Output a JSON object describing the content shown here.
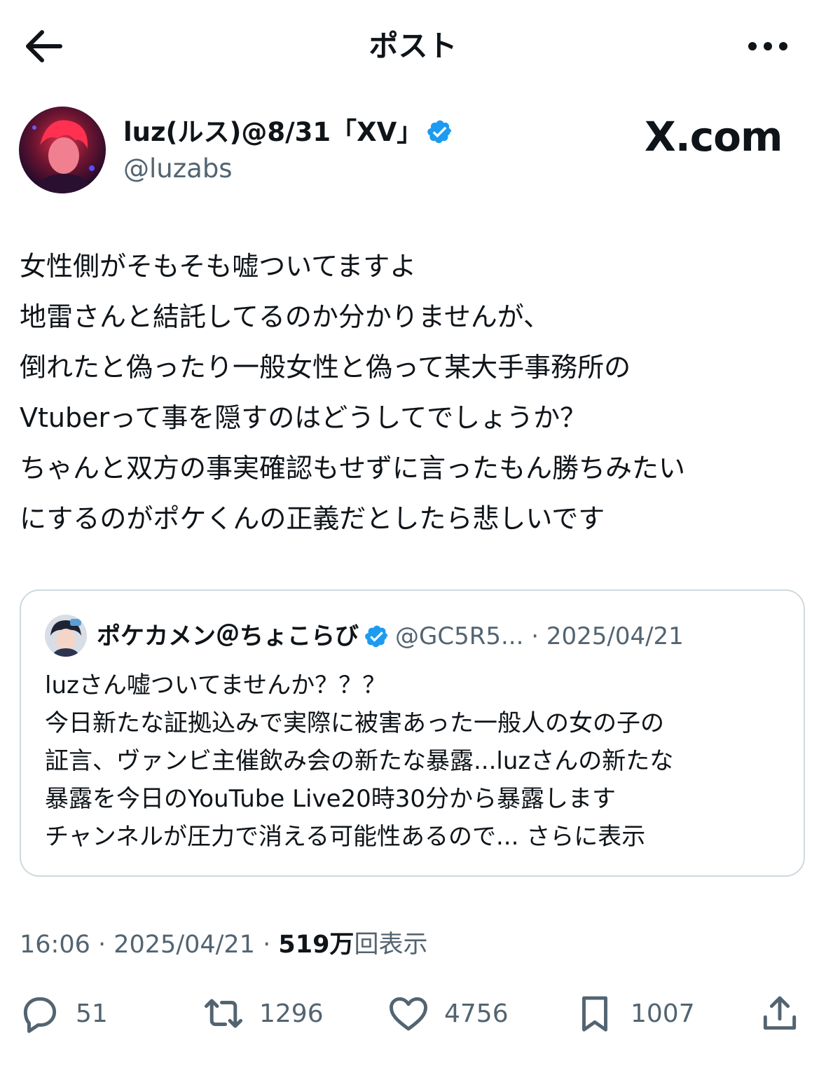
{
  "header": {
    "title": "ポスト"
  },
  "author": {
    "name": "luz(ルス)@8/31「XV」",
    "handle": "@luzabs",
    "watermark": "X.com"
  },
  "post": {
    "lines": [
      "女性側がそもそも嘘ついてますよ",
      "地雷さんと結託してるのか分かりませんが、",
      "倒れたと偽ったり一般女性と偽って某大手事務所の",
      "Vtuberって事を隠すのはどうしてでしょうか？",
      "ちゃんと双方の事実確認もせずに言ったもん勝ちみたい",
      "にするのがポケくんの正義だとしたら悲しいです"
    ]
  },
  "quote": {
    "name": "ポケカメン＠ちょこらび",
    "handle": "@GC5R5...",
    "date": "· 2025/04/21",
    "lines": [
      "luzさん嘘ついてませんか？？？",
      "今日新たな証拠込みで実際に被害あった一般人の女の子の",
      "証言、ヴァンビ主催飲み会の新たな暴露...luzさんの新たな",
      "暴露を今日のYouTube Live20時30分から暴露します",
      "チャンネルが圧力で消える可能性あるので..."
    ],
    "show_more": "さらに表示"
  },
  "meta": {
    "time": "16:06 · 2025/04/21 ·",
    "views_count": "519万",
    "views_label": "回表示"
  },
  "actions": {
    "replies": "51",
    "reposts": "1296",
    "likes": "4756",
    "bookmarks": "1007"
  },
  "colors": {
    "text": "#0f1419",
    "secondary": "#536471",
    "verified": "#1d9bf0",
    "border": "#cfd9de"
  },
  "icons": [
    "back-arrow-icon",
    "more-icon",
    "verified-badge-icon",
    "x-logo-icon",
    "reply-icon",
    "repost-icon",
    "like-icon",
    "bookmark-icon",
    "share-icon"
  ]
}
